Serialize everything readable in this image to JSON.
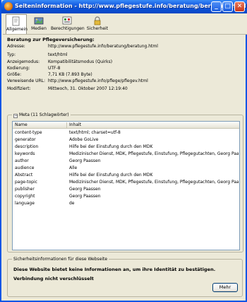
{
  "window": {
    "title": "Seiteninformation - http://www.pflegestufe.info/beratung/beratung.html",
    "minimize": "_",
    "maximize": "□",
    "close": "✕"
  },
  "tabs": [
    {
      "label": "Allgemein",
      "icon": "page-info-icon"
    },
    {
      "label": "Medien",
      "icon": "media-icon"
    },
    {
      "label": "Berechtigungen",
      "icon": "permissions-icon"
    },
    {
      "label": "Sicherheit",
      "icon": "lock-icon"
    }
  ],
  "general": {
    "heading": "Beratung zur Pflegeversicherung:",
    "address_label": "Adresse:",
    "address": "http://www.pflegestufe.info/beratung/beratung.html",
    "type_label": "Typ:",
    "type": "text/html",
    "mode_label": "Anzeigemodus:",
    "mode": "Kompatibilitätsmodus (Quirks)",
    "encoding_label": "Kodierung:",
    "encoding": "UTF-8",
    "size_label": "Größe:",
    "size": "7,71 KB (7.893 Byte)",
    "referrer_label": "Verweisende URL:",
    "referrer": "http://www.pflegestufe.info/pflege/pflegev.html",
    "modified_label": "Modifiziert:",
    "modified": "Mittwoch, 31. Oktober 2007 12:19:40"
  },
  "meta": {
    "legend": "Meta (11 Schlagwörter)",
    "toggle": "−",
    "col_name": "Name",
    "col_content": "Inhalt",
    "rows": [
      {
        "name": "content-type",
        "content": "text/html; charset=utf-8"
      },
      {
        "name": "generator",
        "content": "Adobe GoLive"
      },
      {
        "name": "description",
        "content": "Hilfe bei der Einstufung durch den MDK"
      },
      {
        "name": "keywords",
        "content": "Medizinischer Dienst, MDK, Pflegestufe, Einstufung, Pflegegutachten, Georg Paassen, Pflege..."
      },
      {
        "name": "author",
        "content": "Georg Paassen"
      },
      {
        "name": "audience",
        "content": "Alle"
      },
      {
        "name": "Abstract",
        "content": "Hilfe bei der Einstufung durch den MDK"
      },
      {
        "name": "page-topic",
        "content": "Medizinischer Dienst, MDK, Pflegestufe, Einstufung, Pflegegutachten, Georg Paassen, Pflege..."
      },
      {
        "name": "publisher",
        "content": "Georg Paassen"
      },
      {
        "name": "copyright",
        "content": "Georg Paassen"
      },
      {
        "name": "language",
        "content": "de"
      }
    ]
  },
  "security": {
    "legend": "Sicherheitsinformationen für diese Webseite",
    "line1": "Diese Website bietet keine Informationen an, um ihre Identität zu bestätigen.",
    "line2": "Verbindung nicht verschlüsselt",
    "more_button": "Mehr"
  }
}
